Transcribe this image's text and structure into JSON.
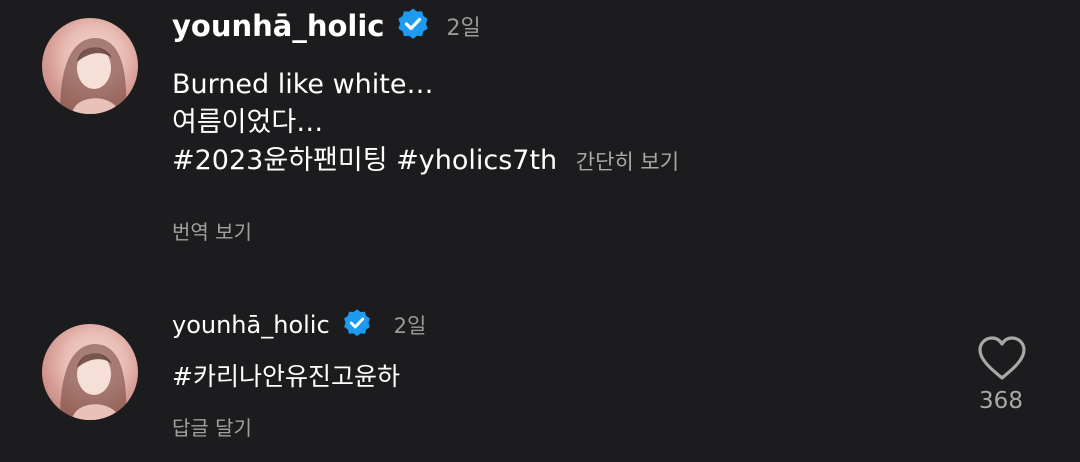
{
  "post": {
    "username": "younhā_holic",
    "time": "2일",
    "caption_line1": "Burned like white…",
    "caption_line2": "여름이었다…",
    "hashtag1": "#2023윤하팬미팅",
    "hashtag2": "#yholics7th",
    "see_brief": "간단히 보기",
    "translate": "번역 보기"
  },
  "comment": {
    "username": "younhā_holic",
    "time": "2일",
    "text": "#카리나안유진고윤하",
    "reply": "답글 달기",
    "likes": "368"
  },
  "colors": {
    "background": "#1c1c1e",
    "verified": "#1d9bf0",
    "secondary_text": "#a8a8a8"
  },
  "icons": [
    "verified-badge-icon",
    "heart-icon",
    "avatar-image"
  ]
}
